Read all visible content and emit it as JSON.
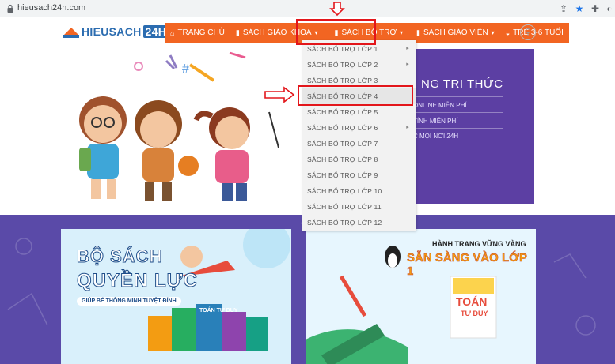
{
  "browser": {
    "url": "hieusach24h.com"
  },
  "site": {
    "logo_text": "HIEUSACH",
    "logo_badge": "24H"
  },
  "nav": {
    "items": [
      {
        "label": "TRANG CHỦ",
        "has_caret": false
      },
      {
        "label": "SÁCH GIÁO KHOA",
        "has_caret": true
      },
      {
        "label": "SÁCH BỔ TRỢ",
        "has_caret": true
      },
      {
        "label": "SÁCH GIÁO VIÊN",
        "has_caret": true
      },
      {
        "label": "TRẺ 3-6 TUỔI",
        "has_caret": false
      }
    ]
  },
  "dropdown": {
    "items": [
      {
        "label": "SÁCH BỔ TRỢ LỚP 1",
        "has_sub": true
      },
      {
        "label": "SÁCH BỔ TRỢ LỚP 2",
        "has_sub": true
      },
      {
        "label": "SÁCH BỔ TRỢ LỚP 3",
        "has_sub": false
      },
      {
        "label": "SÁCH BỔ TRỢ LỚP 4",
        "has_sub": false
      },
      {
        "label": "SÁCH BỔ TRỢ LỚP 5",
        "has_sub": false
      },
      {
        "label": "SÁCH BỔ TRỢ LỚP 6",
        "has_sub": true
      },
      {
        "label": "SÁCH BỔ TRỢ LỚP 7",
        "has_sub": false
      },
      {
        "label": "SÁCH BỔ TRỢ LỚP 8",
        "has_sub": false
      },
      {
        "label": "SÁCH BỔ TRỢ LỚP 9",
        "has_sub": false
      },
      {
        "label": "SÁCH BỔ TRỢ LỚP 10",
        "has_sub": false
      },
      {
        "label": "SÁCH BỔ TRỢ LỚP 11",
        "has_sub": false
      },
      {
        "label": "SÁCH BỔ TRỢ LỚP 12",
        "has_sub": false
      }
    ],
    "highlighted_index": 3
  },
  "hero": {
    "title_partial": "NG TRI THỨC",
    "lines": [
      "ONLINE MIỄN PHÍ",
      "TÍNH MIỄN PHÍ",
      "C MỌI NƠI 24H"
    ]
  },
  "banners": {
    "left": {
      "title1": "BỘ SÁCH",
      "title2": "QUYỀN LỰC",
      "subtitle": "GIÚP BÉ THÔNG MINH TUYỆT ĐỈNH",
      "book_text": "TOÁN TƯ DUY"
    },
    "right": {
      "line1": "HÀNH TRANG VỮNG VÀNG",
      "line2": "SẴN SÀNG VÀO LỚP 1",
      "book_title1": "TOÁN",
      "book_title2": "TƯ DUY"
    }
  },
  "colors": {
    "nav_orange": "#f26522",
    "annotation_red": "#e3161b",
    "purple": "#5a4aa8"
  },
  "icons": [
    "lock-icon",
    "share-icon",
    "star-icon",
    "extension-icon",
    "profile-icon",
    "search-icon",
    "home-icon",
    "book-icon"
  ]
}
